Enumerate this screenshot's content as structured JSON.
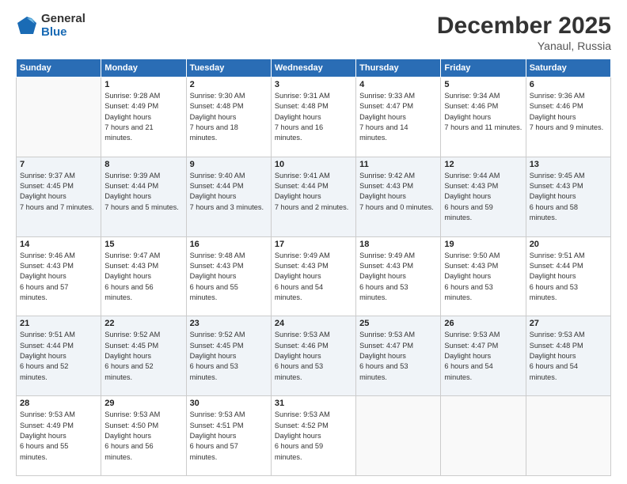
{
  "logo": {
    "general": "General",
    "blue": "Blue"
  },
  "header": {
    "month": "December 2025",
    "location": "Yanaul, Russia"
  },
  "weekdays": [
    "Sunday",
    "Monday",
    "Tuesday",
    "Wednesday",
    "Thursday",
    "Friday",
    "Saturday"
  ],
  "weeks": [
    [
      {
        "day": null
      },
      {
        "day": "1",
        "sunrise": "9:28 AM",
        "sunset": "4:49 PM",
        "daylight": "7 hours and 21 minutes."
      },
      {
        "day": "2",
        "sunrise": "9:30 AM",
        "sunset": "4:48 PM",
        "daylight": "7 hours and 18 minutes."
      },
      {
        "day": "3",
        "sunrise": "9:31 AM",
        "sunset": "4:48 PM",
        "daylight": "7 hours and 16 minutes."
      },
      {
        "day": "4",
        "sunrise": "9:33 AM",
        "sunset": "4:47 PM",
        "daylight": "7 hours and 14 minutes."
      },
      {
        "day": "5",
        "sunrise": "9:34 AM",
        "sunset": "4:46 PM",
        "daylight": "7 hours and 11 minutes."
      },
      {
        "day": "6",
        "sunrise": "9:36 AM",
        "sunset": "4:46 PM",
        "daylight": "7 hours and 9 minutes."
      }
    ],
    [
      {
        "day": "7",
        "sunrise": "9:37 AM",
        "sunset": "4:45 PM",
        "daylight": "7 hours and 7 minutes."
      },
      {
        "day": "8",
        "sunrise": "9:39 AM",
        "sunset": "4:44 PM",
        "daylight": "7 hours and 5 minutes."
      },
      {
        "day": "9",
        "sunrise": "9:40 AM",
        "sunset": "4:44 PM",
        "daylight": "7 hours and 3 minutes."
      },
      {
        "day": "10",
        "sunrise": "9:41 AM",
        "sunset": "4:44 PM",
        "daylight": "7 hours and 2 minutes."
      },
      {
        "day": "11",
        "sunrise": "9:42 AM",
        "sunset": "4:43 PM",
        "daylight": "7 hours and 0 minutes."
      },
      {
        "day": "12",
        "sunrise": "9:44 AM",
        "sunset": "4:43 PM",
        "daylight": "6 hours and 59 minutes."
      },
      {
        "day": "13",
        "sunrise": "9:45 AM",
        "sunset": "4:43 PM",
        "daylight": "6 hours and 58 minutes."
      }
    ],
    [
      {
        "day": "14",
        "sunrise": "9:46 AM",
        "sunset": "4:43 PM",
        "daylight": "6 hours and 57 minutes."
      },
      {
        "day": "15",
        "sunrise": "9:47 AM",
        "sunset": "4:43 PM",
        "daylight": "6 hours and 56 minutes."
      },
      {
        "day": "16",
        "sunrise": "9:48 AM",
        "sunset": "4:43 PM",
        "daylight": "6 hours and 55 minutes."
      },
      {
        "day": "17",
        "sunrise": "9:49 AM",
        "sunset": "4:43 PM",
        "daylight": "6 hours and 54 minutes."
      },
      {
        "day": "18",
        "sunrise": "9:49 AM",
        "sunset": "4:43 PM",
        "daylight": "6 hours and 53 minutes."
      },
      {
        "day": "19",
        "sunrise": "9:50 AM",
        "sunset": "4:43 PM",
        "daylight": "6 hours and 53 minutes."
      },
      {
        "day": "20",
        "sunrise": "9:51 AM",
        "sunset": "4:44 PM",
        "daylight": "6 hours and 53 minutes."
      }
    ],
    [
      {
        "day": "21",
        "sunrise": "9:51 AM",
        "sunset": "4:44 PM",
        "daylight": "6 hours and 52 minutes."
      },
      {
        "day": "22",
        "sunrise": "9:52 AM",
        "sunset": "4:45 PM",
        "daylight": "6 hours and 52 minutes."
      },
      {
        "day": "23",
        "sunrise": "9:52 AM",
        "sunset": "4:45 PM",
        "daylight": "6 hours and 53 minutes."
      },
      {
        "day": "24",
        "sunrise": "9:53 AM",
        "sunset": "4:46 PM",
        "daylight": "6 hours and 53 minutes."
      },
      {
        "day": "25",
        "sunrise": "9:53 AM",
        "sunset": "4:47 PM",
        "daylight": "6 hours and 53 minutes."
      },
      {
        "day": "26",
        "sunrise": "9:53 AM",
        "sunset": "4:47 PM",
        "daylight": "6 hours and 54 minutes."
      },
      {
        "day": "27",
        "sunrise": "9:53 AM",
        "sunset": "4:48 PM",
        "daylight": "6 hours and 54 minutes."
      }
    ],
    [
      {
        "day": "28",
        "sunrise": "9:53 AM",
        "sunset": "4:49 PM",
        "daylight": "6 hours and 55 minutes."
      },
      {
        "day": "29",
        "sunrise": "9:53 AM",
        "sunset": "4:50 PM",
        "daylight": "6 hours and 56 minutes."
      },
      {
        "day": "30",
        "sunrise": "9:53 AM",
        "sunset": "4:51 PM",
        "daylight": "6 hours and 57 minutes."
      },
      {
        "day": "31",
        "sunrise": "9:53 AM",
        "sunset": "4:52 PM",
        "daylight": "6 hours and 59 minutes."
      },
      {
        "day": null
      },
      {
        "day": null
      },
      {
        "day": null
      }
    ]
  ]
}
